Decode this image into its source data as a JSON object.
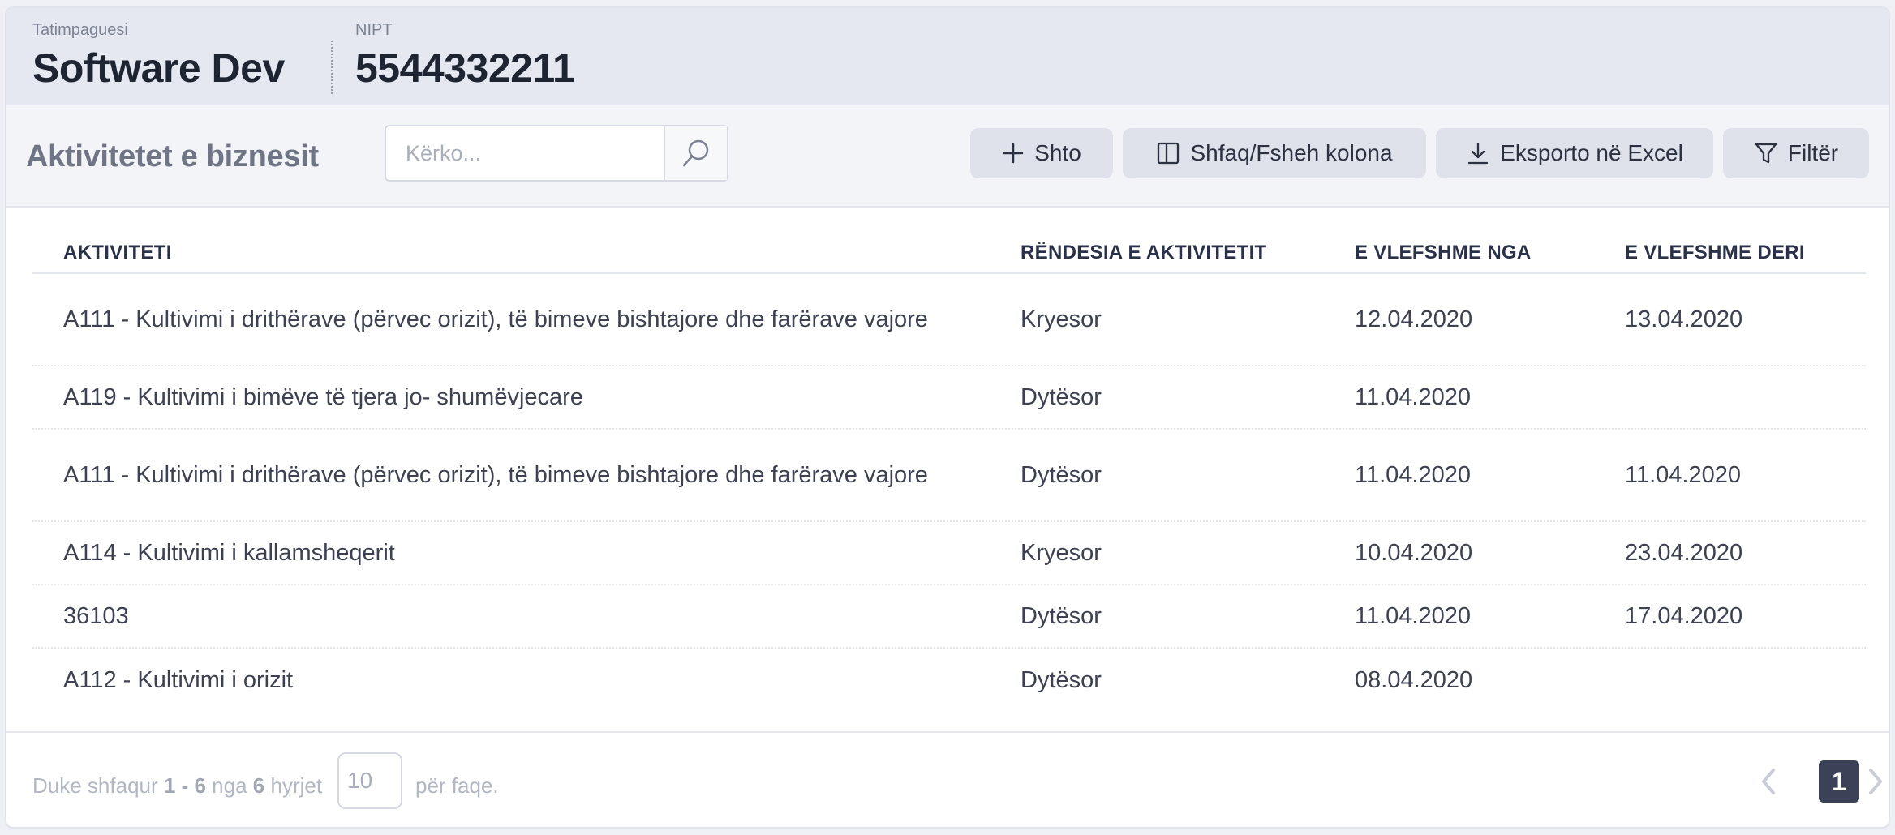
{
  "header": {
    "taxpayer_label": "Tatimpaguesi",
    "taxpayer_name": "Software Dev",
    "nipt_label": "NIPT",
    "nipt_value": "5544332211"
  },
  "toolbar": {
    "title": "Aktivitetet e biznesit",
    "search_placeholder": "Kërko...",
    "add_label": "Shto",
    "columns_label": "Shfaq/Fsheh kolona",
    "export_label": "Eksporto në Excel",
    "filter_label": "Filtër"
  },
  "table": {
    "headers": [
      "AKTIVITETI",
      "RËNDESIA E AKTIVITETIT",
      "E VLEFSHME NGA",
      "E VLEFSHME DERI"
    ],
    "rows": [
      {
        "activity": "A111 - Kultivimi i drithërave (përvec orizit), të bimeve bishtajore dhe farërave vajore",
        "importance": "Kryesor",
        "from": "12.04.2020",
        "to": "13.04.2020"
      },
      {
        "activity": "A119 - Kultivimi i bimëve të tjera jo- shumëvjecare",
        "importance": "Dytësor",
        "from": "11.04.2020",
        "to": ""
      },
      {
        "activity": "A111 - Kultivimi i drithërave (përvec orizit), të bimeve bishtajore dhe farërave vajore",
        "importance": "Dytësor",
        "from": "11.04.2020",
        "to": "11.04.2020"
      },
      {
        "activity": "A114 - Kultivimi i kallamsheqerit",
        "importance": "Kryesor",
        "from": "10.04.2020",
        "to": "23.04.2020"
      },
      {
        "activity": "36103",
        "importance": "Dytësor",
        "from": "11.04.2020",
        "to": "17.04.2020"
      },
      {
        "activity": "A112 - Kultivimi i orizit",
        "importance": "Dytësor",
        "from": "08.04.2020",
        "to": ""
      }
    ]
  },
  "footer": {
    "showing_prefix": "Duke shfaqur",
    "range": "1 - 6",
    "of_word": "nga",
    "total": "6",
    "entries_word": "hyrjet",
    "per_page_value": "10",
    "per_page_suffix": "për faqe.",
    "current_page": "1"
  },
  "colors": {
    "header_bg": "#e5e8f1",
    "toolbar_bg": "#f3f4f8",
    "button_bg": "#dfe2ea",
    "active_page": "#3b4257"
  }
}
